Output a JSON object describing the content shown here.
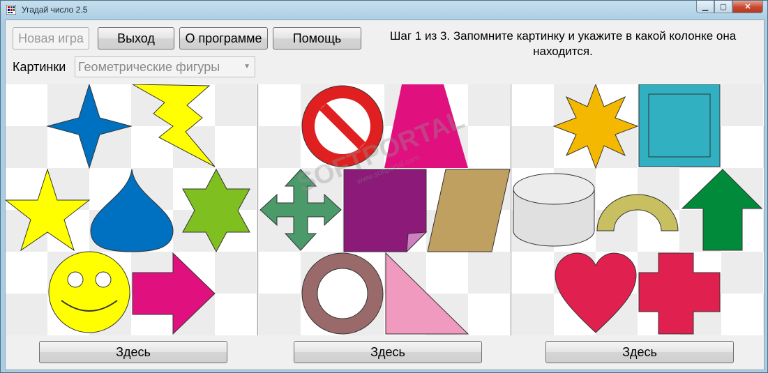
{
  "window": {
    "title": "Угадай число 2.5",
    "minimize": "▁",
    "maximize": "▢",
    "close": "✕"
  },
  "toolbar": {
    "new_game": "Новая игра",
    "exit": "Выход",
    "about": "О программе",
    "help": "Помощь"
  },
  "instruction": "Шаг 1 из 3. Запомните картинку и укажите в какой колонке она находится.",
  "pictures": {
    "label": "Картинки",
    "selected": "Геометрические фигуры"
  },
  "columns": [
    {
      "shapes": [
        "four-point-star-blue",
        "lightning-yellow",
        "star-yellow",
        "drop-blue",
        "hexagram-green",
        "smiley-yellow",
        "arrow-magenta"
      ],
      "button": "Здесь"
    },
    {
      "shapes": [
        "no-sign-red",
        "trapezoid-magenta",
        "cross-arrows-green",
        "folded-page-purple",
        "parallelogram-tan",
        "ring-brown",
        "triangle-pink"
      ],
      "button": "Здесь"
    },
    {
      "shapes": [
        "star-orange",
        "bevel-square-teal",
        "cylinder-gray",
        "arch-olive",
        "arrow-up-green",
        "heart-red",
        "plus-red"
      ],
      "button": "Здесь"
    }
  ],
  "watermark": {
    "text": "SOFTPORTAL",
    "url": "www.softportal.com"
  },
  "colors": {
    "blue": "#0070c0",
    "yellow": "#ffff00",
    "green": "#7fbf20",
    "magenta": "#e0107f",
    "red": "#e02020",
    "purple": "#8b1a78",
    "tan": "#c0a060",
    "brown": "#9a6a6a",
    "pink": "#f09ac0",
    "orange": "#f5b800",
    "teal": "#30b0c0",
    "heart": "#e0204f"
  }
}
